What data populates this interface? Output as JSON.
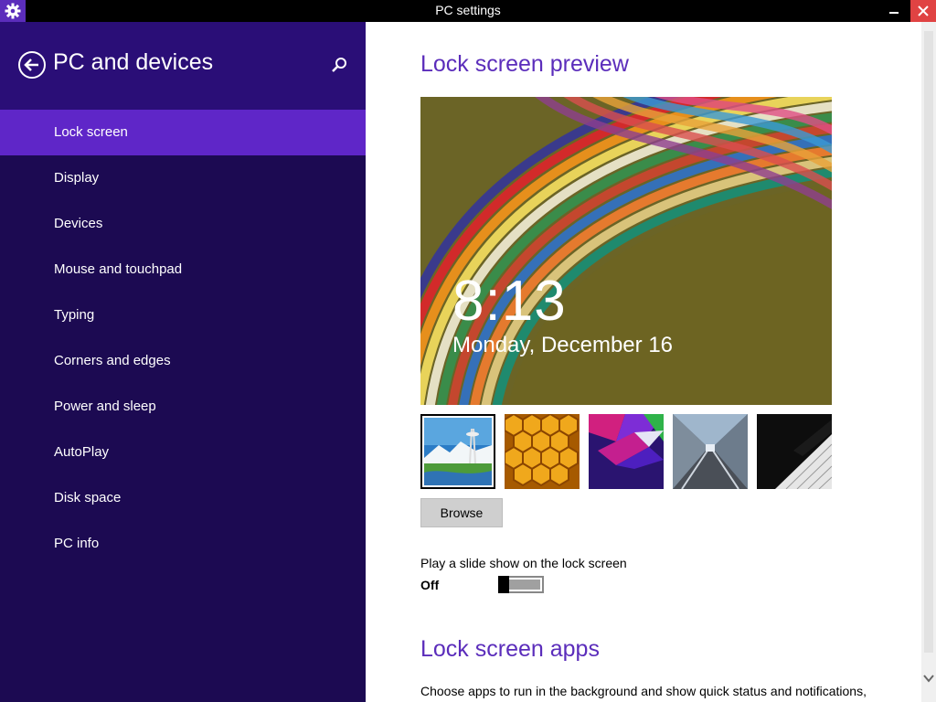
{
  "window": {
    "title": "PC settings",
    "app_icon": "gear-icon",
    "minimize_icon": "minimize-icon",
    "close_icon": "close-icon",
    "close_color": "#e04343"
  },
  "sidebar": {
    "heading": "PC and devices",
    "back_icon": "back-arrow-icon",
    "search_icon": "search-icon",
    "accent": "#5f26c8",
    "background": "#1c0a52",
    "items": [
      {
        "label": "Lock screen",
        "active": true
      },
      {
        "label": "Display"
      },
      {
        "label": "Devices"
      },
      {
        "label": "Mouse and touchpad"
      },
      {
        "label": "Typing"
      },
      {
        "label": "Corners and edges"
      },
      {
        "label": "Power and sleep"
      },
      {
        "label": "AutoPlay"
      },
      {
        "label": "Disk space"
      },
      {
        "label": "PC info"
      }
    ]
  },
  "main": {
    "preview_title": "Lock screen preview",
    "preview": {
      "time": "8:13",
      "date": "Monday, December 16"
    },
    "thumbnails": [
      {
        "name": "space-needle-thumbnail",
        "selected": true
      },
      {
        "name": "honeycomb-thumbnail"
      },
      {
        "name": "geometric-thumbnail"
      },
      {
        "name": "tunnel-thumbnail"
      },
      {
        "name": "piano-keys-thumbnail"
      }
    ],
    "browse_label": "Browse",
    "slideshow_label": "Play a slide show on the lock screen",
    "slideshow_state": "Off",
    "apps_title": "Lock screen apps",
    "apps_description": "Choose apps to run in the background and show quick status and notifications,",
    "title_color": "#5b2dbb"
  }
}
